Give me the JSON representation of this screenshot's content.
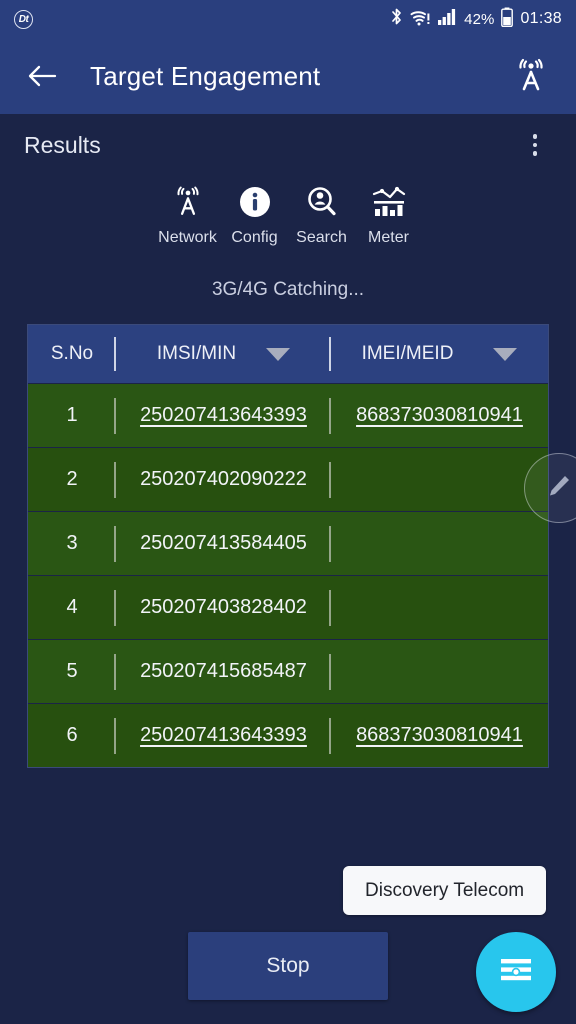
{
  "status_bar": {
    "app_badge": "Dt",
    "bluetooth_icon": "bluetooth-icon",
    "wifi_icon": "wifi-warning-icon",
    "signal_icon": "cellular-signal-icon",
    "battery_percent": "42%",
    "battery_icon": "battery-icon",
    "time": "01:38"
  },
  "app_bar": {
    "back_icon": "back-arrow-icon",
    "title": "Target Engagement",
    "action_icon": "antenna-tower-icon"
  },
  "section": {
    "title": "Results",
    "overflow_icon": "more-vertical-icon"
  },
  "toolbar": {
    "items": [
      {
        "label": "Network",
        "icon": "antenna-tower-icon"
      },
      {
        "label": "Config",
        "icon": "info-circle-icon"
      },
      {
        "label": "Search",
        "icon": "search-person-icon"
      },
      {
        "label": "Meter",
        "icon": "chart-meter-icon"
      }
    ]
  },
  "status_text": "3G/4G Catching...",
  "table": {
    "columns": [
      {
        "label": "S.No",
        "filter": false
      },
      {
        "label": "IMSI/MIN",
        "filter": true
      },
      {
        "label": "IMEI/MEID",
        "filter": true
      }
    ],
    "rows": [
      {
        "sno": "1",
        "imsi": "250207413643393",
        "imei": "868373030810941",
        "linked": true
      },
      {
        "sno": "2",
        "imsi": "250207402090222",
        "imei": "",
        "linked": false
      },
      {
        "sno": "3",
        "imsi": "250207413584405",
        "imei": "",
        "linked": false
      },
      {
        "sno": "4",
        "imsi": "250207403828402",
        "imei": "",
        "linked": false
      },
      {
        "sno": "5",
        "imsi": "250207415685487",
        "imei": "",
        "linked": false
      },
      {
        "sno": "6",
        "imsi": "250207413643393",
        "imei": "868373030810941",
        "linked": true
      }
    ]
  },
  "edit_button": {
    "icon": "pencil-edit-icon"
  },
  "fab_chip": {
    "label": "Discovery Telecom"
  },
  "stop_button": {
    "label": "Stop"
  },
  "fab": {
    "icon": "sliders-settings-icon"
  },
  "colors": {
    "background": "#1b2447",
    "app_bar": "#2a3f7e",
    "table_header": "#2c4180",
    "row_green": "#2a5614",
    "fab_cyan": "#28c6ed",
    "chip_white": "#f7f8fa",
    "text_light": "#e9ecf4"
  }
}
